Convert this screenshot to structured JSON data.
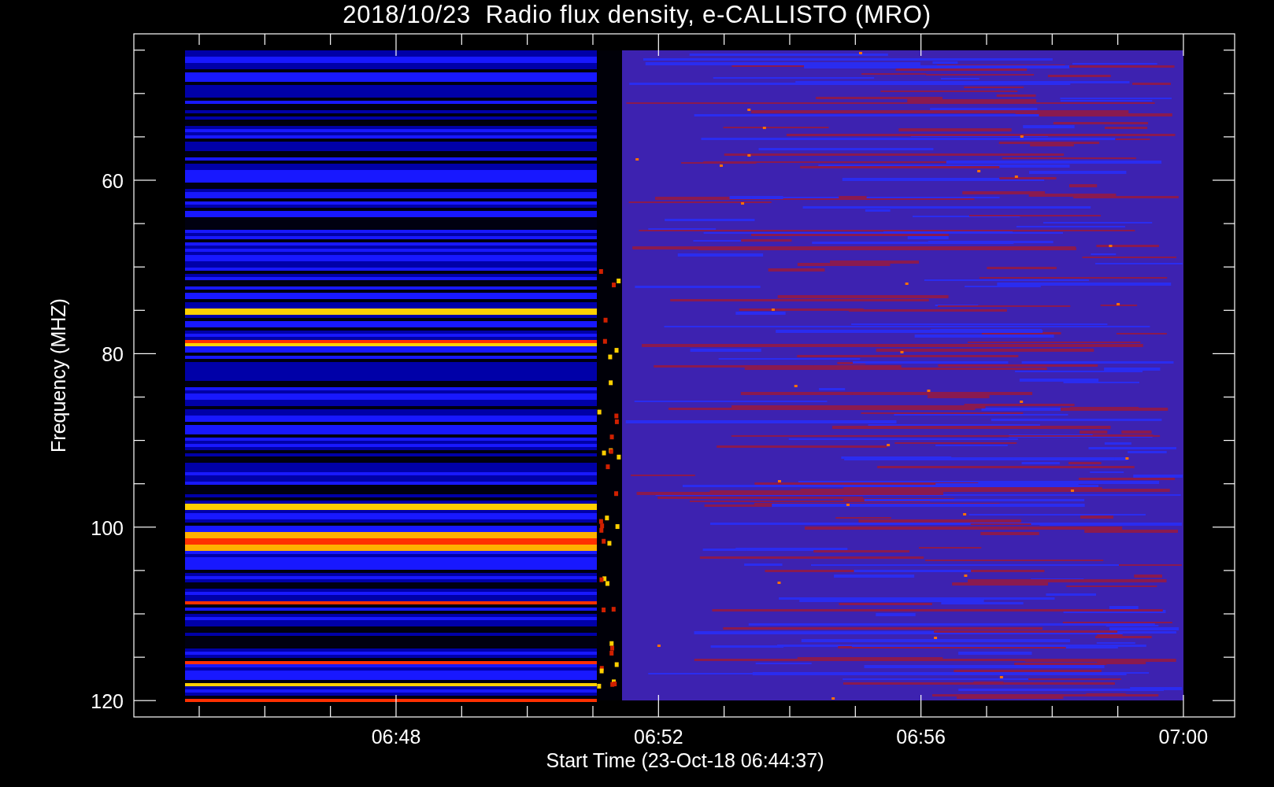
{
  "title": "2018/10/23  Radio flux density, e-CALLISTO (MRO)",
  "plot": {
    "ylabel": "Frequency (MHZ)",
    "xlabel": "Start Time (23-Oct-18 06:44:37)",
    "yticks": [
      "60",
      "80",
      "100",
      "120"
    ],
    "xticks": [
      "06:48",
      "06:52",
      "06:56",
      "07:00"
    ]
  }
}
